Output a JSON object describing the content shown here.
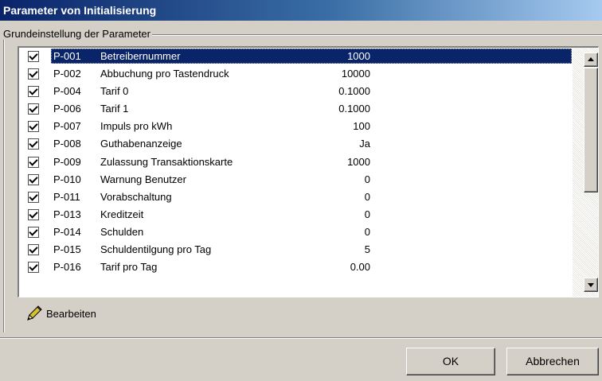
{
  "window": {
    "title": "Parameter von Initialisierung"
  },
  "group": {
    "label": "Grundeinstellung der Parameter"
  },
  "parameters": [
    {
      "code": "P-001",
      "name": "Betreibernummer",
      "value": "1000",
      "checked": true,
      "selected": true
    },
    {
      "code": "P-002",
      "name": "Abbuchung pro Tastendruck",
      "value": "10000",
      "checked": true,
      "selected": false
    },
    {
      "code": "P-004",
      "name": "Tarif 0",
      "value": "0.1000",
      "checked": true,
      "selected": false
    },
    {
      "code": "P-006",
      "name": "Tarif 1",
      "value": "0.1000",
      "checked": true,
      "selected": false
    },
    {
      "code": "P-007",
      "name": "Impuls pro kWh",
      "value": "100",
      "checked": true,
      "selected": false
    },
    {
      "code": "P-008",
      "name": "Guthabenanzeige",
      "value": "Ja",
      "checked": true,
      "selected": false
    },
    {
      "code": "P-009",
      "name": "Zulassung Transaktionskarte",
      "value": "1000",
      "checked": true,
      "selected": false
    },
    {
      "code": "P-010",
      "name": "Warnung Benutzer",
      "value": "0",
      "checked": true,
      "selected": false
    },
    {
      "code": "P-011",
      "name": "Vorabschaltung",
      "value": "0",
      "checked": true,
      "selected": false
    },
    {
      "code": "P-013",
      "name": "Kreditzeit",
      "value": "0",
      "checked": true,
      "selected": false
    },
    {
      "code": "P-014",
      "name": "Schulden",
      "value": "0",
      "checked": true,
      "selected": false
    },
    {
      "code": "P-015",
      "name": "Schuldentilgung pro Tag",
      "value": "5",
      "checked": true,
      "selected": false
    },
    {
      "code": "P-016",
      "name": "Tarif pro Tag",
      "value": "0.00",
      "checked": true,
      "selected": false
    }
  ],
  "actions": {
    "edit_label": "Bearbeiten",
    "edit_icon": "pencil-icon"
  },
  "footer": {
    "ok_label": "OK",
    "cancel_label": "Abbrechen"
  },
  "colors": {
    "selection": "#0a246a",
    "face": "#d4d0c8",
    "title_start": "#0a246a",
    "title_end": "#a6caf0"
  }
}
